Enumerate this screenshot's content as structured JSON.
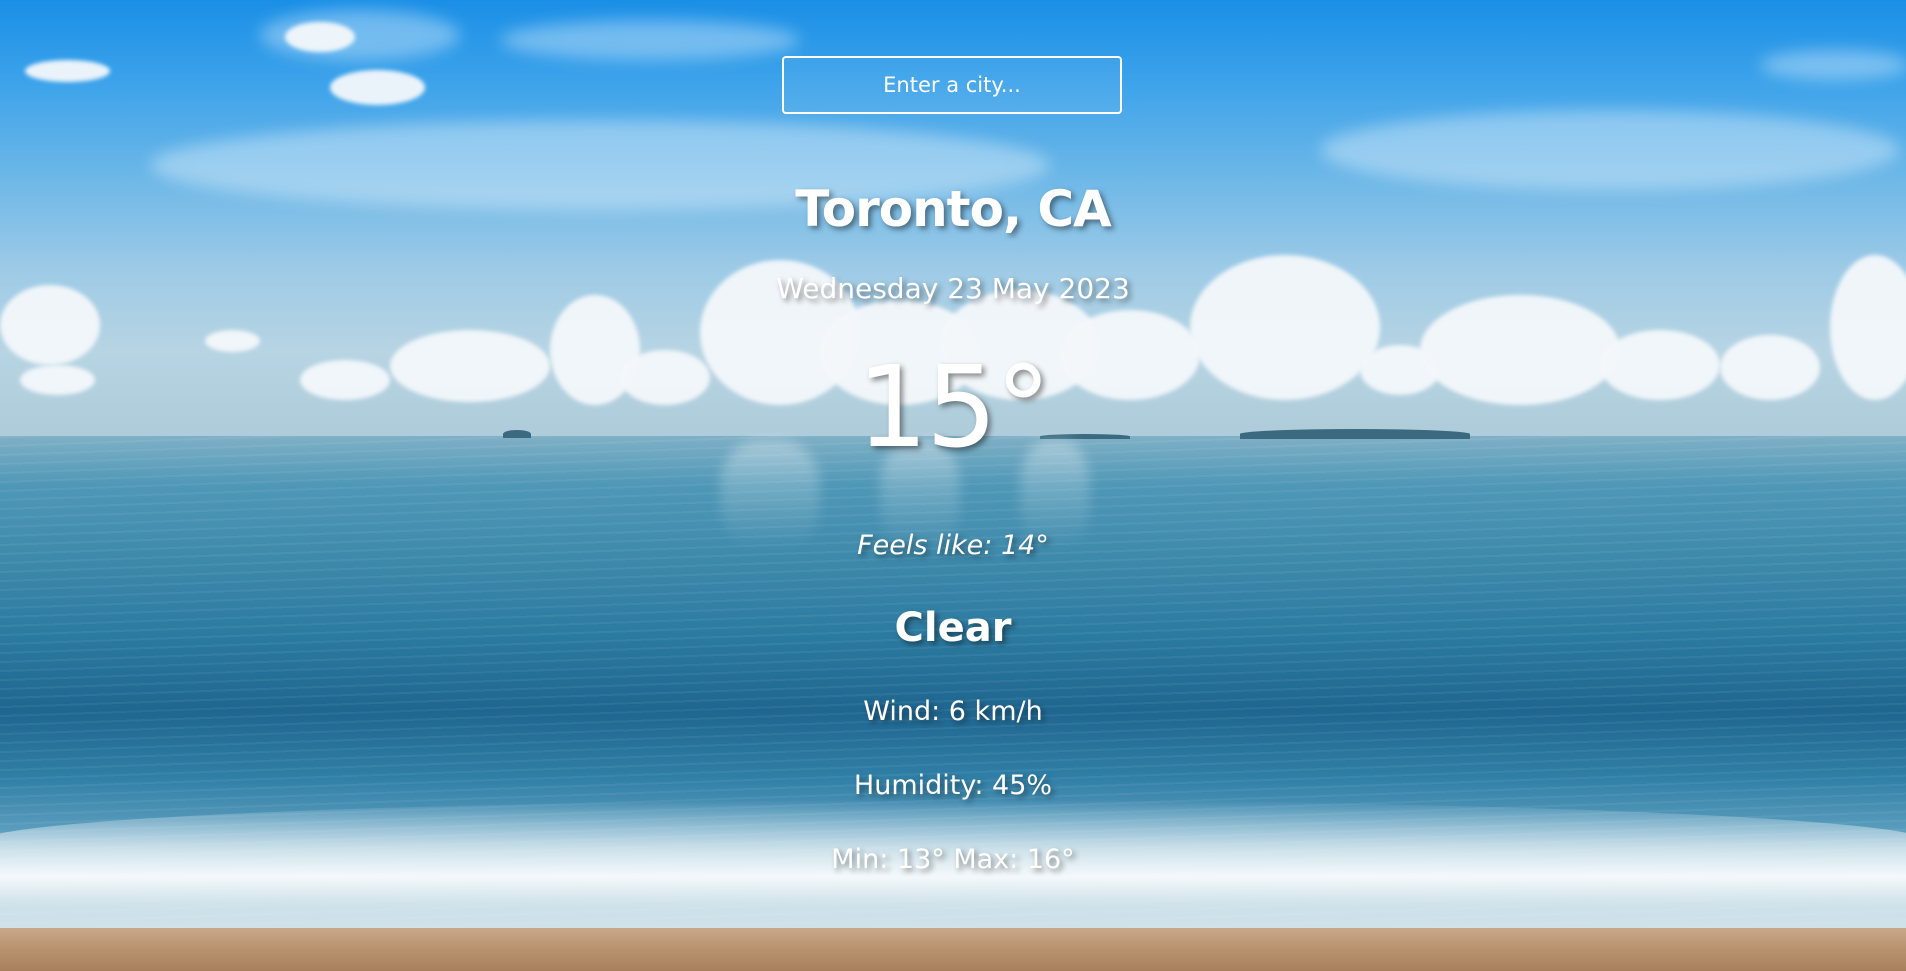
{
  "search": {
    "placeholder": "Enter a city..."
  },
  "weather": {
    "location": "Toronto, CA",
    "date": "Wednesday 23 May 2023",
    "temperature": "15°",
    "feels_like": "Feels like: 14°",
    "condition": "Clear",
    "wind": "Wind: 6 km/h",
    "humidity": "Humidity: 45%",
    "min_max": "Min: 13° Max: 16°"
  },
  "colors": {
    "text": "#ffffff",
    "sky_top": "#1a8fe6",
    "sea": "#2b7aa0",
    "sand": "#b8926f"
  }
}
